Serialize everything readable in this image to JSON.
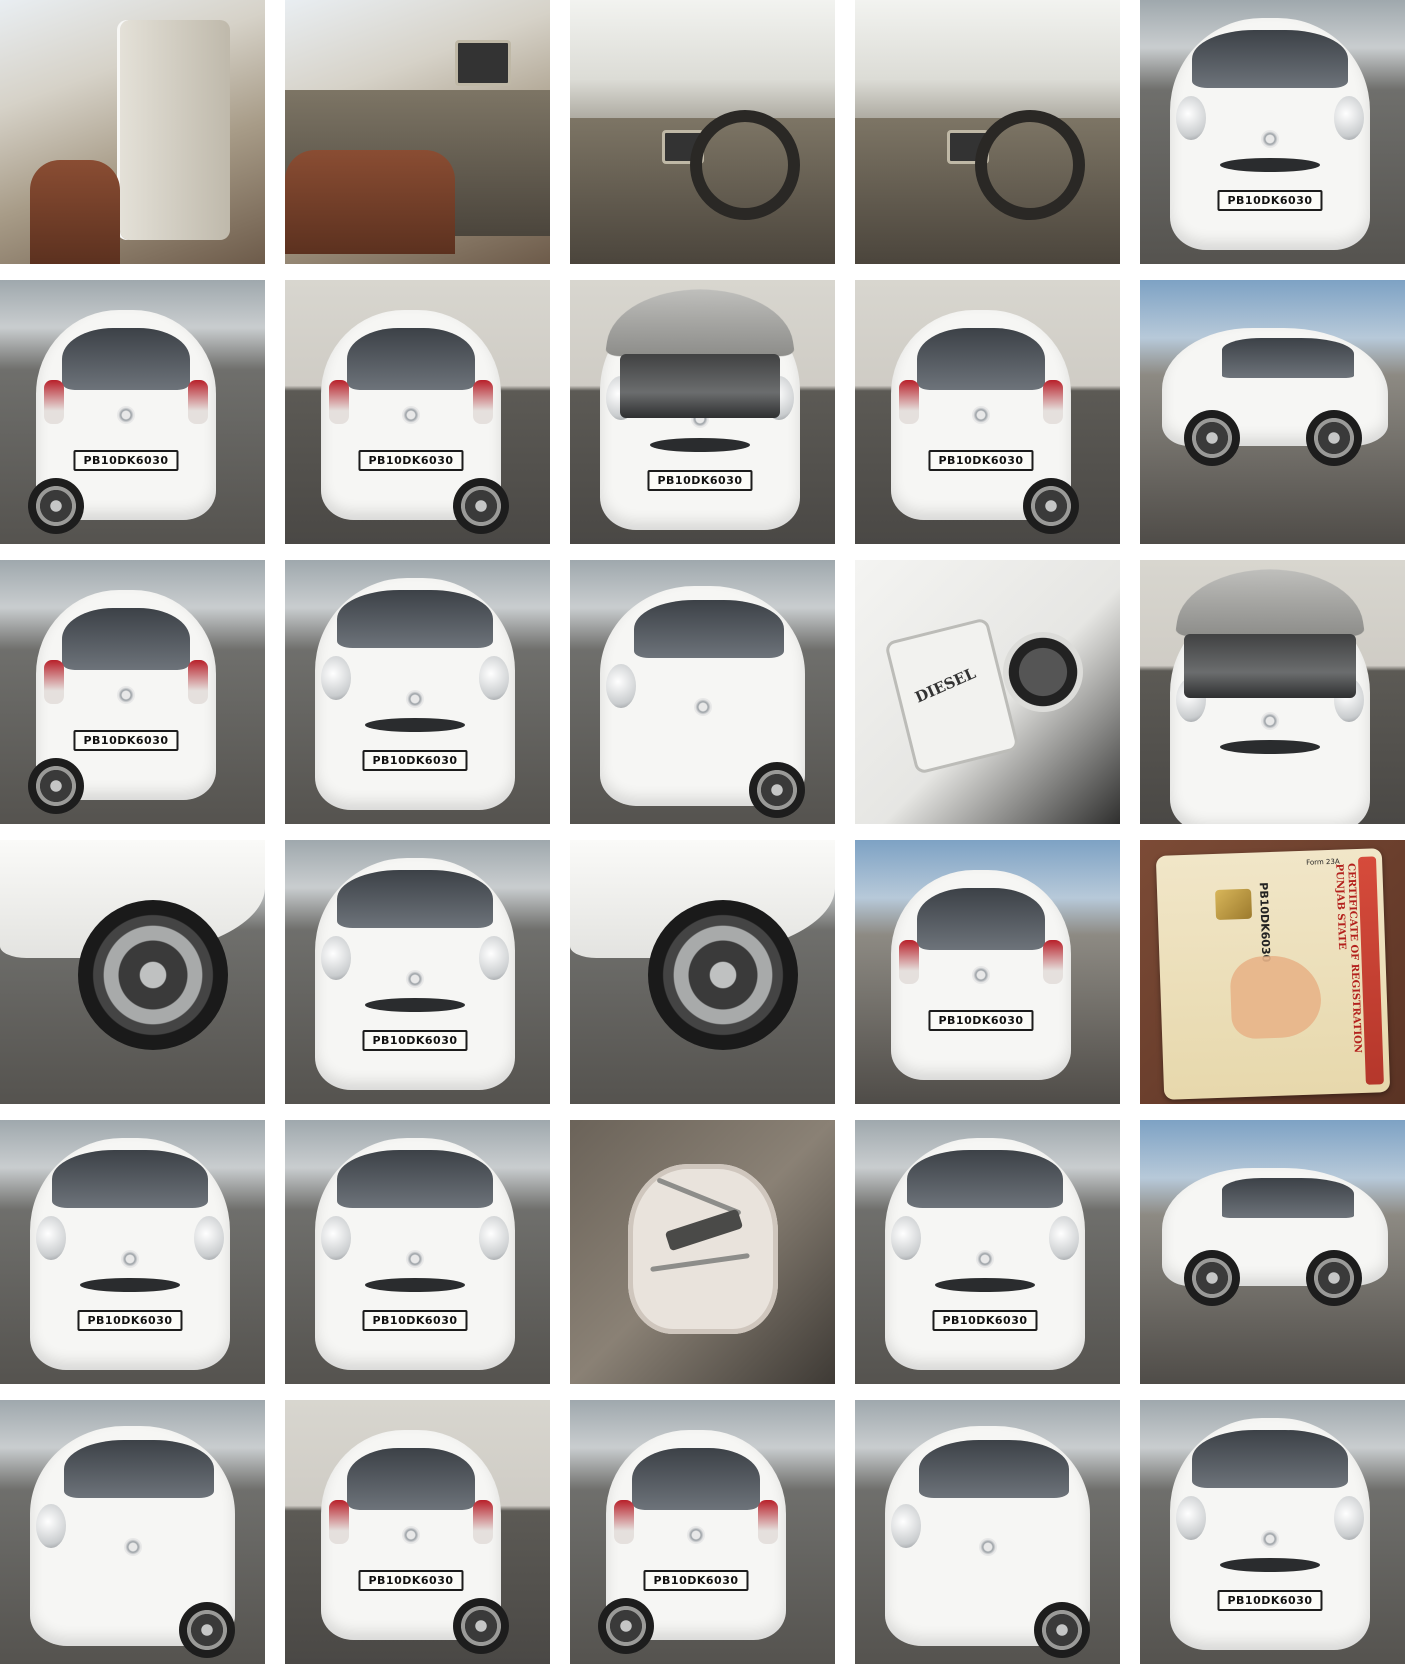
{
  "plate_text": "PB10DK6030",
  "fuel_label": "DIESEL",
  "registration_card": {
    "title": "CERTIFICATE OF REGISTRATION PUNJAB STATE",
    "reg_no": "PB10DK6030",
    "form": "Form 23A"
  }
}
